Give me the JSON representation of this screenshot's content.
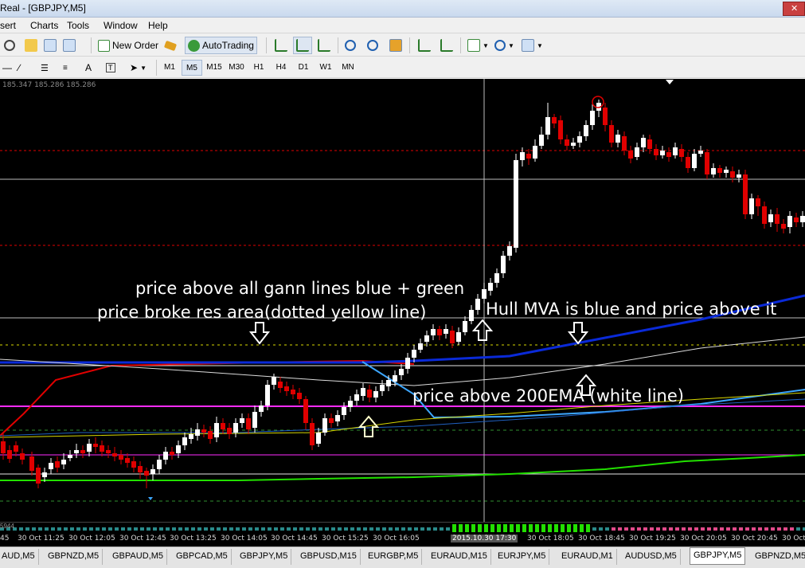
{
  "window": {
    "title": "Real - [GBPJPY,M5]"
  },
  "menu": [
    "sert",
    "Charts",
    "Tools",
    "Window",
    "Help"
  ],
  "toolbar": {
    "new_order_label": "New Order",
    "autotrading_label": "AutoTrading"
  },
  "timeframes": [
    "M1",
    "M5",
    "M15",
    "M30",
    "H1",
    "H4",
    "D1",
    "W1",
    "MN"
  ],
  "active_timeframe": "M5",
  "chart": {
    "quote": "185.347 185.286 185.286",
    "sub_label": "5944",
    "annotations": [
      "price above all gann lines blue + green",
      "price broke res area(dotted yellow line)",
      "Hull MVA is blue and price above it",
      "price above 200EMA (white line)"
    ],
    "colors": {
      "background": "#000000",
      "bull": "#ffffff",
      "bear": "#e00000",
      "gann_blue": "#3da7ff",
      "gann_green": "#22e000",
      "hull_blue": "#0a2ad8",
      "ema_white": "#dcdcdc",
      "magenta": "#ff2bff",
      "red_line": "#e00000",
      "res_yellow": "#d8d800"
    }
  },
  "time_axis": [
    "45",
    "30 Oct 11:25",
    "30 Oct 12:05",
    "30 Oct 12:45",
    "30 Oct 13:25",
    "30 Oct 14:05",
    "30 Oct 14:45",
    "30 Oct 15:25",
    "30 Oct 16:05",
    "2015.10.30 17:30",
    "30 Oct 18:05",
    "30 Oct 18:45",
    "30 Oct 19:25",
    "30 Oct 20:05",
    "30 Oct 20:45",
    "30 Oct"
  ],
  "tabs": [
    "AUD,M5",
    "GBPNZD,M5",
    "GBPAUD,M5",
    "GBPCAD,M5",
    "GBPJPY,M5",
    "GBPUSD,M15",
    "EURGBP,M5",
    "EURAUD,M15",
    "EURJPY,M5",
    "EURAUD,M1",
    "AUDUSD,M5",
    "GBPJPY,M5",
    "GBPNZD,M5"
  ],
  "active_tab": 11
}
